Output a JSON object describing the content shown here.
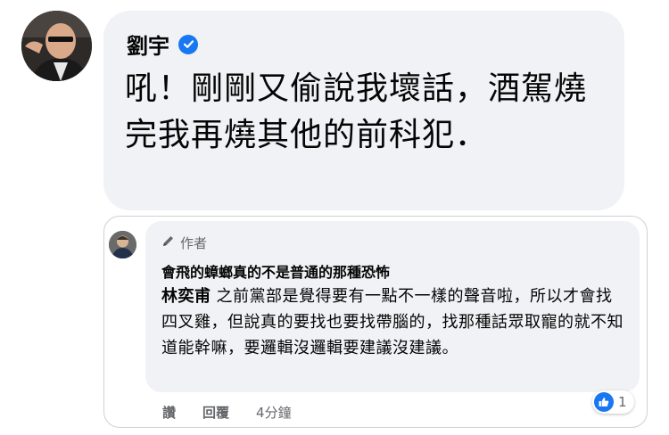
{
  "comment": {
    "author": "劉宇",
    "text": "吼！剛剛又偷說我壞話，酒駕燒完我再燒其他的前科犯．",
    "verified_icon": "verified-badge-icon"
  },
  "reply": {
    "badge": "作者",
    "badge_icon": "pencil-icon",
    "name": "會飛的蟑螂真的不是普通的那種恐怖",
    "mention": "林奕甫",
    "text": "之前黨部是覺得要有一點不一樣的聲音啦，所以才會找四叉雞，但說真的要找也要找帶腦的，找那種話眾取寵的就不知道能幹嘛，要邏輯沒邏輯要建議沒建議。",
    "reaction_count": "1",
    "reaction_icon": "like-icon"
  },
  "actions": {
    "like": "讚",
    "reply": "回覆",
    "time": "4分鐘"
  },
  "colors": {
    "bubble": "#f0f2f5",
    "accent": "#1877f2",
    "secondary_text": "#65676b"
  }
}
